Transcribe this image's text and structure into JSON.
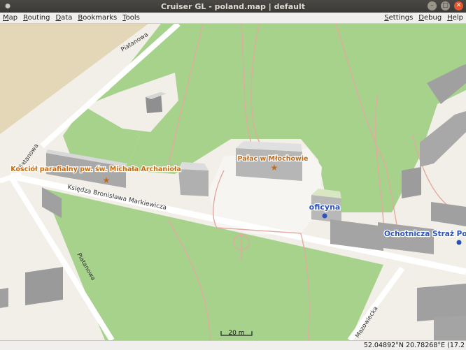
{
  "window": {
    "title": "Cruiser GL - poland.map | default"
  },
  "menu": {
    "left": [
      {
        "label": "Map",
        "accel": "M",
        "rest": "ap"
      },
      {
        "label": "Routing",
        "accel": "R",
        "rest": "outing"
      },
      {
        "label": "Data",
        "accel": "D",
        "rest": "ata"
      },
      {
        "label": "Bookmarks",
        "accel": "B",
        "rest": "ookmarks"
      },
      {
        "label": "Tools",
        "accel": "T",
        "rest": "ools"
      }
    ],
    "right": [
      {
        "label": "Settings",
        "accel": "S",
        "rest": "ettings"
      },
      {
        "label": "Debug",
        "accel": "D",
        "rest": "ebug"
      },
      {
        "label": "Help",
        "accel": "H",
        "rest": "elp"
      }
    ]
  },
  "map": {
    "streets": {
      "piatanowa_top": "Piatanowa",
      "piatanowa_left": "Piatanowa",
      "piatanowa_bottom": "Piatanowa",
      "ksiedza": "Księdza Bronisława Markiewicza",
      "mazowiecka": "Mazowiecka"
    },
    "pois": {
      "kosciol": "Kościół parafialny pw. św. Michała Archanioła",
      "palac": "Pałac w Młochowie",
      "oficyna": "oficyna",
      "straz": "Ochotnicza Straż Poża"
    },
    "scale": "20 m",
    "colors": {
      "park": "#a6d28c",
      "sand": "#e3d7b8",
      "built": "#f2efe9",
      "road": "#ffffff",
      "path": "#e4a9a0",
      "poi_orange": "#c26a14",
      "poi_blue": "#2a52b8"
    }
  },
  "status": {
    "coords": "52.04892°N 20.78268°E (17.2"
  }
}
